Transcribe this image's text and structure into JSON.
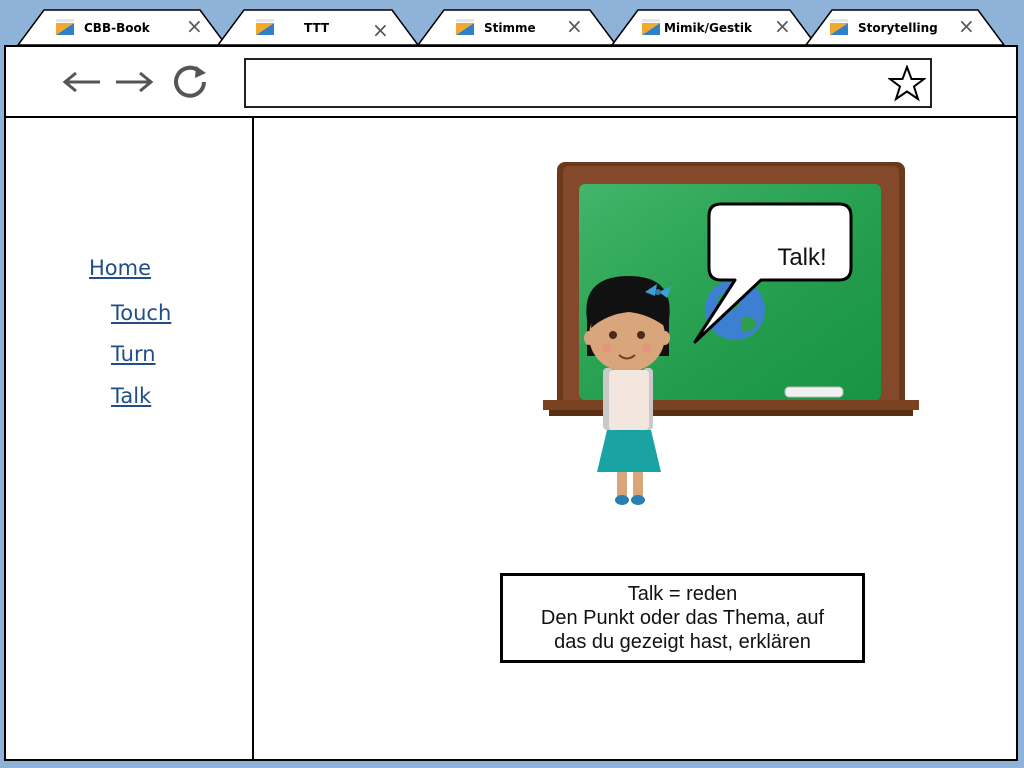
{
  "tabs": [
    {
      "title": "CBB-Book",
      "active": false
    },
    {
      "title": "TTT",
      "active": true
    },
    {
      "title": "Stimme",
      "active": false
    },
    {
      "title": "Mimik/Gestik",
      "active": false
    },
    {
      "title": "Storytelling",
      "active": false
    }
  ],
  "tab_close_glyph": "×",
  "toolbar": {
    "back_icon": "back-arrow-icon",
    "forward_icon": "forward-arrow-icon",
    "reload_icon": "reload-icon",
    "address_value": "",
    "address_placeholder": "",
    "bookmark_icon": "star-icon"
  },
  "sidebar": {
    "home": "Home",
    "items": [
      {
        "label": "Touch"
      },
      {
        "label": "Turn"
      },
      {
        "label": "Talk"
      }
    ]
  },
  "main": {
    "speech_bubble": "Talk!",
    "caption_lines": [
      "Talk = reden",
      "Den Punkt oder das Thema, auf",
      "das du gezeigt hast, erklären"
    ]
  },
  "colors": {
    "page_background": "#8fb2d9",
    "link": "#1f4e8a",
    "chalkboard_green": "#1aa64a",
    "frame_brown": "#6b3a1c",
    "skirt_teal": "#1aa3a3",
    "bow_blue": "#3aa0d8"
  }
}
